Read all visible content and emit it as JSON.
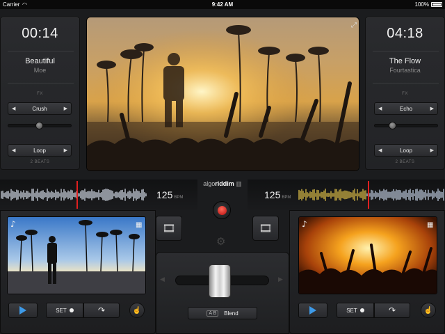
{
  "status_bar": {
    "carrier": "Carrier",
    "time": "9:42 AM",
    "battery": "100%"
  },
  "deck_left": {
    "time": "00:14",
    "title": "Beautiful",
    "artist": "Moe",
    "fx_label": "FX",
    "fx_value": "Crush",
    "fx_level": 0.35,
    "loop_value": "Loop",
    "beats_label": "2 BEATS",
    "bpm": "125",
    "bpm_unit": "BPM",
    "set_label": "SET"
  },
  "deck_right": {
    "time": "04:18",
    "title": "The Flow",
    "artist": "Fourtastica",
    "fx_label": "FX",
    "fx_value": "Echo",
    "fx_level": 0.2,
    "loop_value": "Loop",
    "beats_label": "2 BEATS",
    "bpm": "125",
    "bpm_unit": "BPM",
    "set_label": "SET"
  },
  "center": {
    "logo_light": "algo",
    "logo_bold": "riddim",
    "crossfader_position": 0.5,
    "blend_label": "Blend",
    "ab_label": "A B"
  },
  "colors": {
    "accent_blue": "#3d9ae8",
    "record_red": "#d01414",
    "playhead_red": "#e02020",
    "wave_left": "#dfe7f3",
    "wave_right_played": "#e8c84a",
    "wave_right": "#c9d6ea"
  },
  "icons": {
    "expand": "expand-icon",
    "settings": "gear-icon",
    "music_note": "music-note-icon",
    "film": "film-icon",
    "redo": "redo-arrow-icon",
    "scratch": "scratch-icon"
  }
}
